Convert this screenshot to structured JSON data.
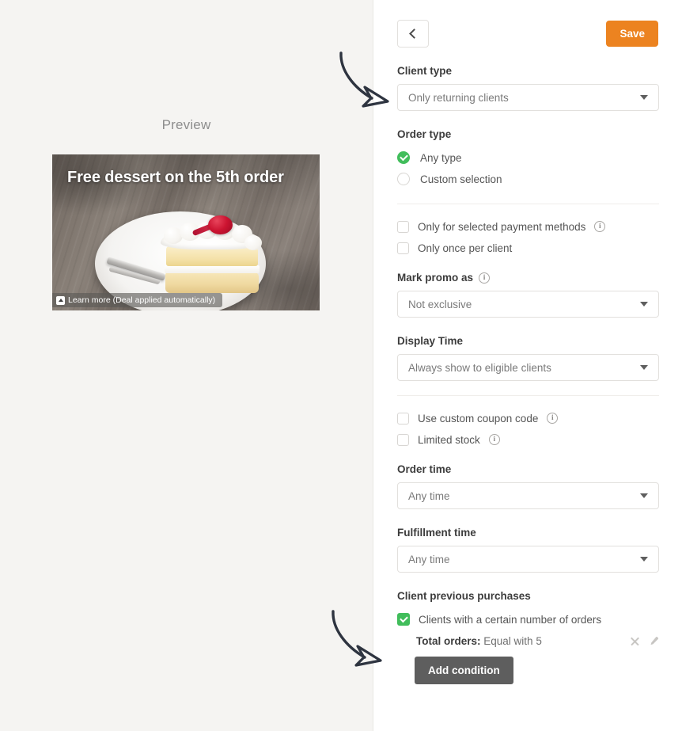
{
  "preview": {
    "title": "Preview",
    "promo_headline": "Free dessert on the 5th order",
    "learn_more": "Learn more (Deal applied automatically)",
    "image_subject": "slice of layered cake with whipped cream and cherry on white plate"
  },
  "toolbar": {
    "back_label": "",
    "save_label": "Save",
    "save_color": "#ec8320"
  },
  "form": {
    "client_type": {
      "label": "Client type",
      "value": "Only returning clients"
    },
    "order_type": {
      "label": "Order type",
      "options": [
        {
          "label": "Any type",
          "selected": true
        },
        {
          "label": "Custom selection",
          "selected": false
        }
      ]
    },
    "checkboxes_group_1": [
      {
        "label": "Only for selected payment methods",
        "checked": false,
        "info": true
      },
      {
        "label": "Only once per client",
        "checked": false,
        "info": false
      }
    ],
    "mark_promo_as": {
      "label": "Mark promo as",
      "info": true,
      "value": "Not exclusive"
    },
    "display_time": {
      "label": "Display Time",
      "value": "Always show to eligible clients"
    },
    "checkboxes_group_2": [
      {
        "label": "Use custom coupon code",
        "checked": false,
        "info": true
      },
      {
        "label": "Limited stock",
        "checked": false,
        "info": true
      }
    ],
    "order_time": {
      "label": "Order time",
      "value": "Any time"
    },
    "fulfillment_time": {
      "label": "Fulfillment time",
      "value": "Any time"
    },
    "client_previous_purchases": {
      "label": "Client previous purchases",
      "checkbox_label": "Clients with a certain number of orders",
      "checkbox_checked": true,
      "condition_prefix": "Total orders:",
      "condition_value": "Equal with 5",
      "add_condition_label": "Add condition"
    }
  },
  "icons": {
    "back": "chevron-left-icon",
    "dropdown": "caret-down-icon",
    "info": "i",
    "remove": "close-icon",
    "edit": "pencil-icon",
    "learn_more": "expand-icon"
  },
  "colors": {
    "accent_green": "#41bd5b",
    "accent_orange": "#ec8320",
    "panel_bg": "#f5f4f2",
    "button_gray": "#5e5e5e"
  },
  "annotations": [
    {
      "name": "arrow-to-client-type",
      "target": "client-type-select"
    },
    {
      "name": "arrow-to-client-previous-purchases",
      "target": "clients-with-orders-checkbox"
    }
  ]
}
